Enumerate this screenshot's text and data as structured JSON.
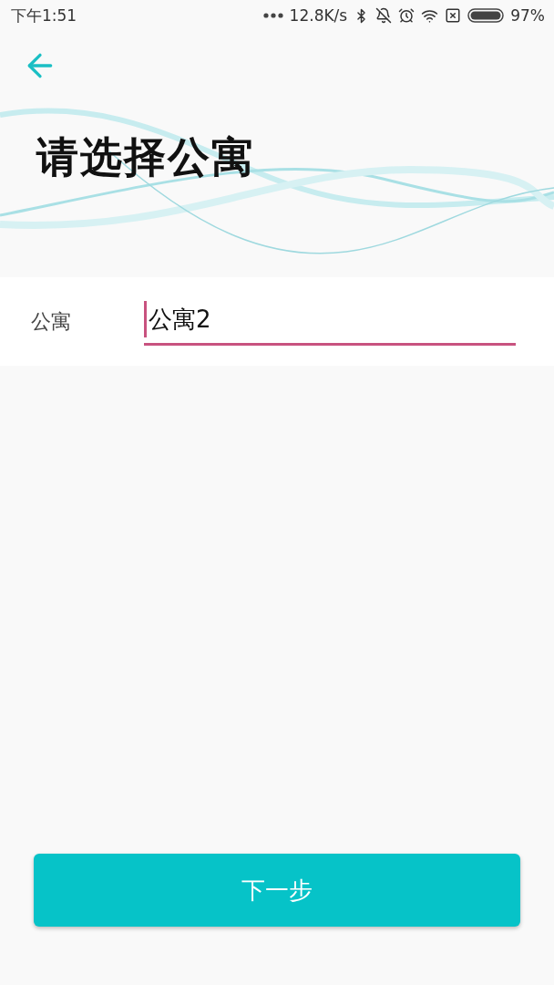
{
  "status_bar": {
    "time": "下午1:51",
    "net_speed": "12.8K/s",
    "battery": "97%"
  },
  "header": {
    "title": "请选择公寓"
  },
  "form": {
    "label": "公寓",
    "value": "公寓2"
  },
  "next_button": {
    "label": "下一步"
  }
}
